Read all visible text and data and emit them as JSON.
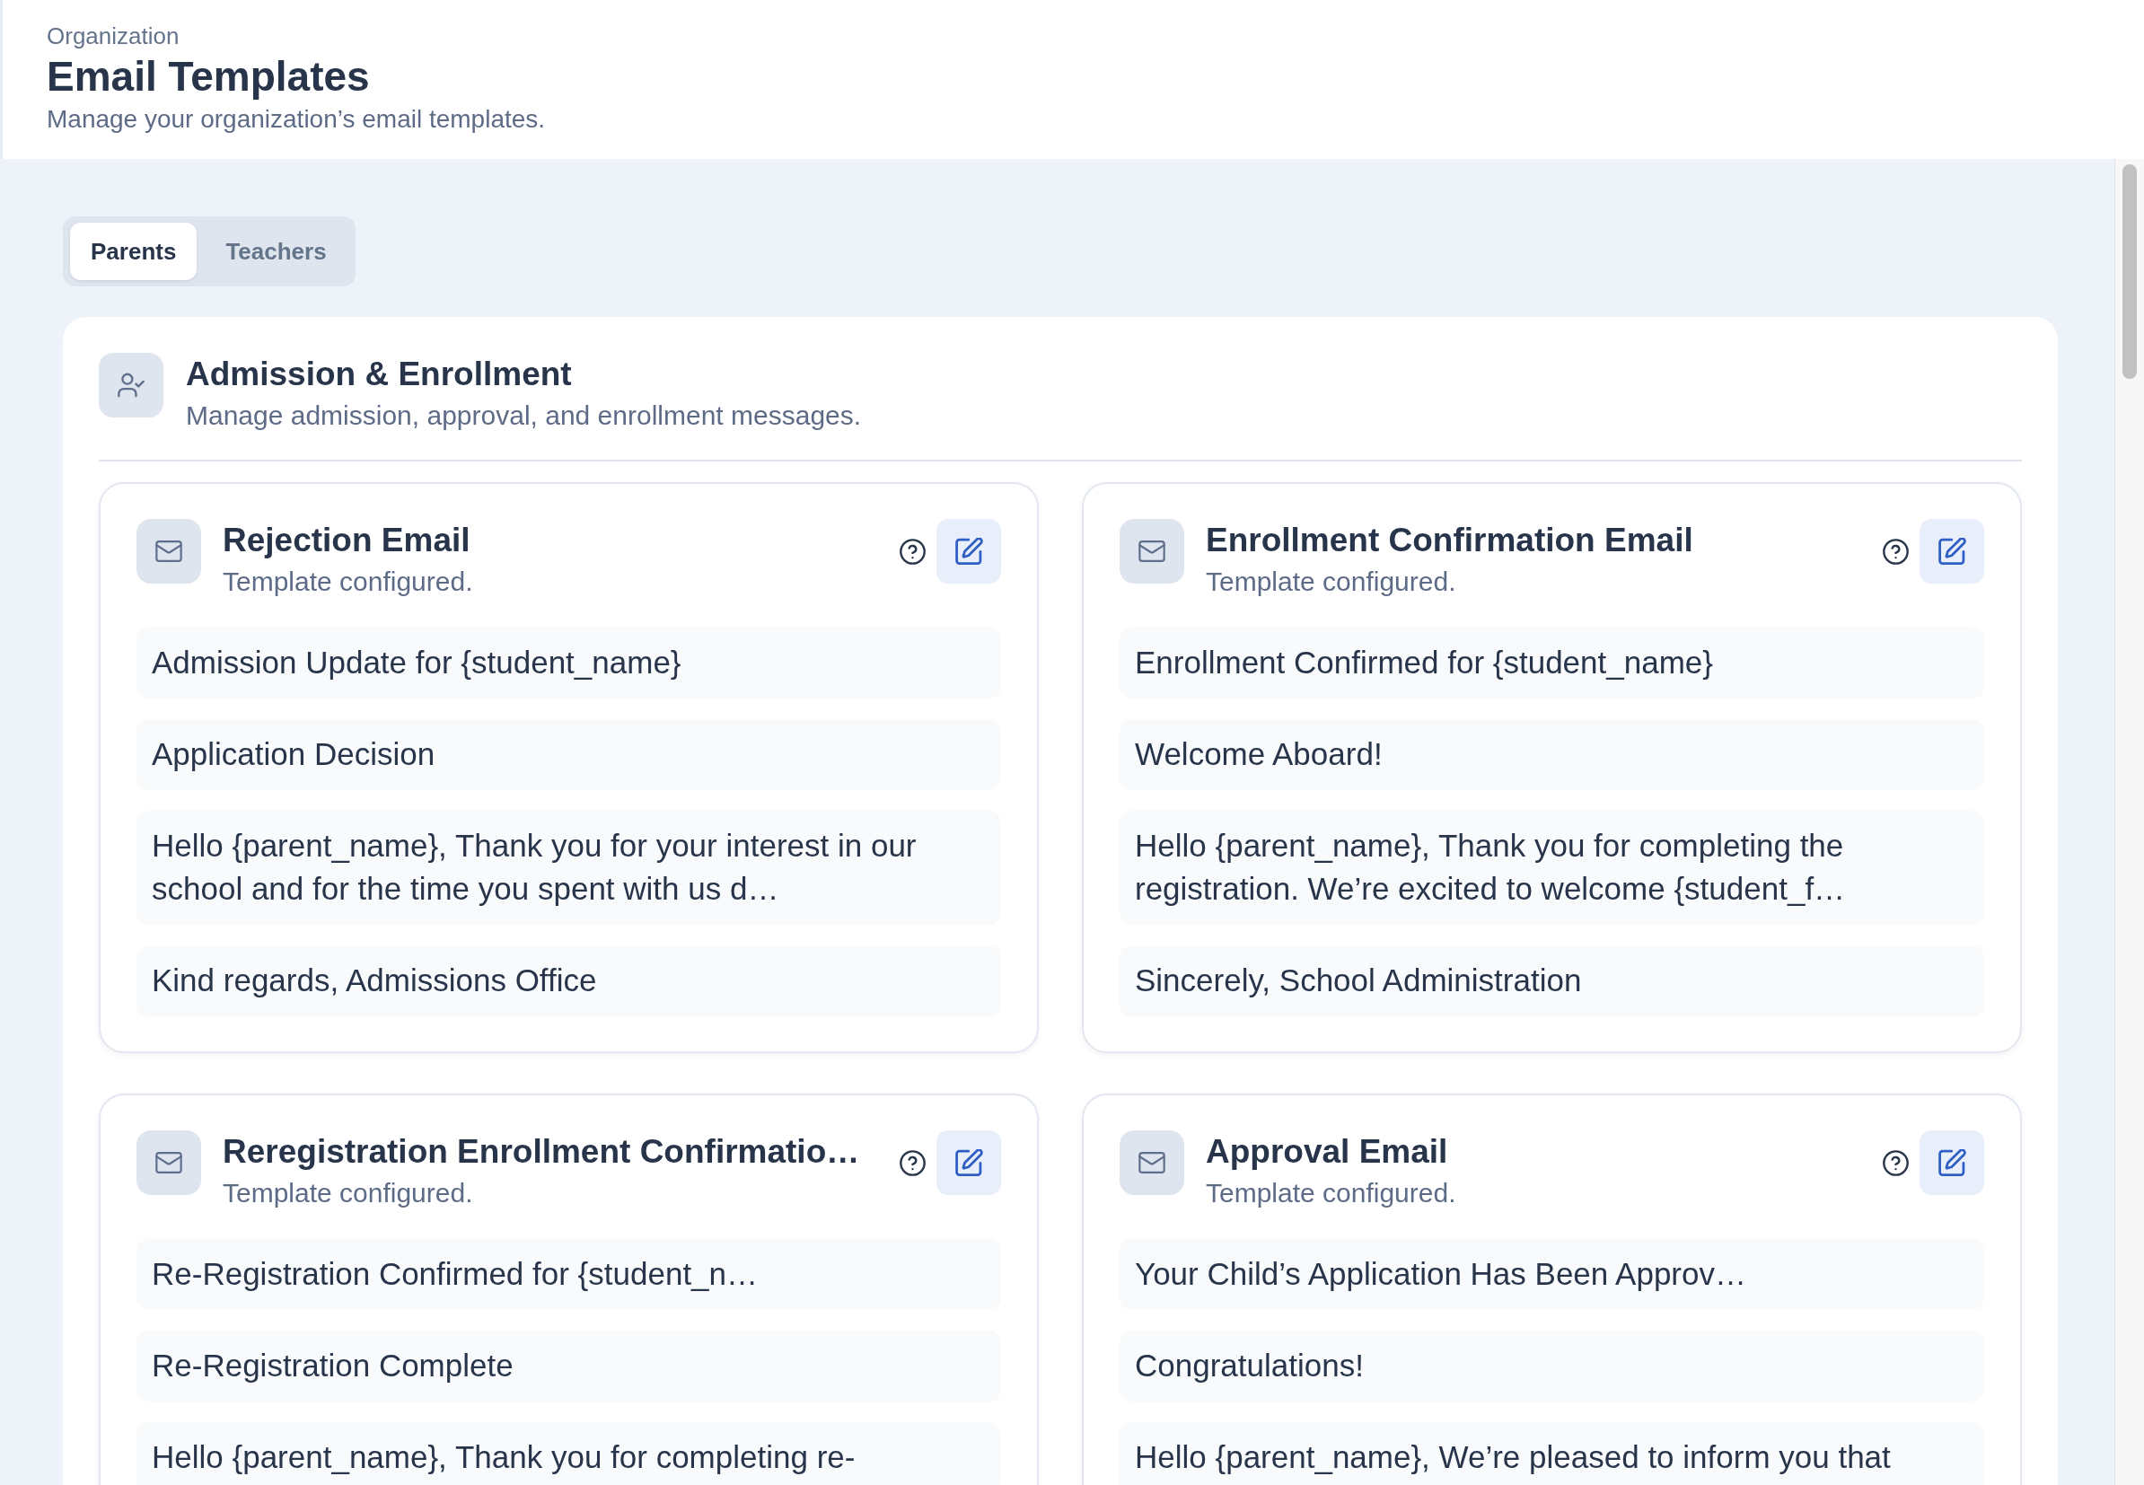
{
  "header": {
    "breadcrumb": "Organization",
    "title": "Email Templates",
    "subtitle": "Manage your organization’s email templates."
  },
  "tabs": [
    {
      "label": "Parents",
      "selected": true
    },
    {
      "label": "Teachers",
      "selected": false
    }
  ],
  "sections": [
    {
      "title": "Admission & Enrollment",
      "subtitle": "Manage admission, approval, and enrollment messages.",
      "templates": [
        {
          "title": "Rejection Email",
          "status": "Template configured.",
          "lines": [
            "Admission Update for {student_name}",
            "Application Decision",
            "Hello {parent_name}, Thank you for your interest in our school and for the time you spent with us d…",
            "Kind regards, Admissions Office"
          ]
        },
        {
          "title": "Enrollment Confirmation Email",
          "status": "Template configured.",
          "lines": [
            "Enrollment Confirmed for {student_name}",
            "Welcome Aboard!",
            "Hello {parent_name}, Thank you for completing the registration. We’re excited to welcome {student_f…",
            "Sincerely, School Administration"
          ]
        },
        {
          "title": "Reregistration Enrollment Confirmatio…",
          "status": "Template configured.",
          "lines": [
            "Re-Registration Confirmed for {student_n…",
            "Re-Registration Complete",
            "Hello {parent_name}, Thank you for completing re-"
          ]
        },
        {
          "title": "Approval Email",
          "status": "Template configured.",
          "lines": [
            "Your Child’s Application Has Been Approv…",
            "Congratulations!",
            "Hello {parent_name}, We’re pleased to inform you that"
          ]
        }
      ]
    }
  ]
}
